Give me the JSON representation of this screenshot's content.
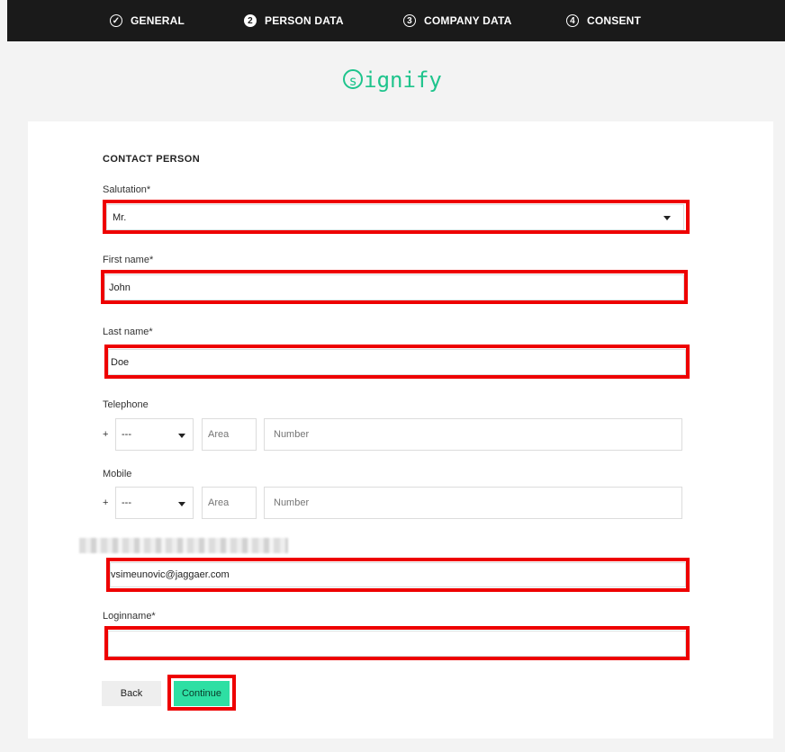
{
  "stepper": {
    "steps": [
      {
        "label": "GENERAL",
        "marker": "✓",
        "state": "done"
      },
      {
        "label": "PERSON DATA",
        "marker": "2",
        "state": "active"
      },
      {
        "label": "COMPANY DATA",
        "marker": "3",
        "state": "pending"
      },
      {
        "label": "CONSENT",
        "marker": "4",
        "state": "pending"
      }
    ]
  },
  "brand": {
    "logo_mark": "s",
    "logo_text": "ignify",
    "color": "#1ec48c"
  },
  "form": {
    "section_title": "CONTACT PERSON",
    "salutation": {
      "label": "Salutation*",
      "value": "Mr."
    },
    "first_name": {
      "label": "First name*",
      "value": "John"
    },
    "last_name": {
      "label": "Last name*",
      "value": "Doe"
    },
    "telephone": {
      "label": "Telephone",
      "prefix": "+",
      "country_value": "---",
      "area_placeholder": "Area",
      "number_placeholder": "Number"
    },
    "mobile": {
      "label": "Mobile",
      "prefix": "+",
      "country_value": "---",
      "area_placeholder": "Area",
      "number_placeholder": "Number"
    },
    "email": {
      "value": "vsimeunovic@jaggaer.com"
    },
    "loginname": {
      "label": "Loginname*",
      "value": ""
    }
  },
  "actions": {
    "back_label": "Back",
    "continue_label": "Continue"
  },
  "colors": {
    "highlight": "#ee0000",
    "accent": "#2edfa3",
    "topbar": "#1a1a1a"
  }
}
